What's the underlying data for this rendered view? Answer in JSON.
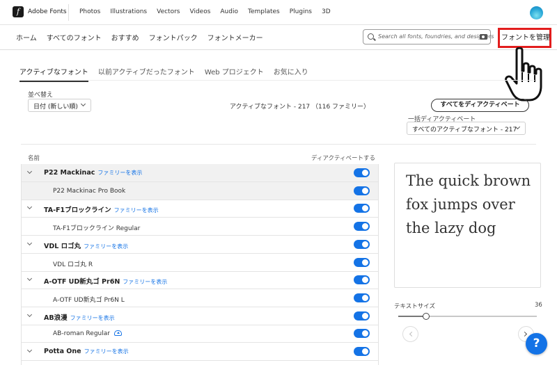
{
  "brand": {
    "name": "Adobe Fonts",
    "logo_glyph": "f"
  },
  "top_nav": [
    "Photos",
    "Illustrations",
    "Vectors",
    "Videos",
    "Audio",
    "Templates",
    "Plugins",
    "3D"
  ],
  "sub_nav": [
    "ホーム",
    "すべてのフォント",
    "おすすめ",
    "フォントパック",
    "フォントメーカー"
  ],
  "search": {
    "placeholder": "Search all fonts, foundries, and designers"
  },
  "manage_button": "フォントを管理",
  "tabs": [
    {
      "label": "アクティブなフォント",
      "active": true
    },
    {
      "label": "以前アクティブだったフォント",
      "active": false
    },
    {
      "label": "Web プロジェクト",
      "active": false
    },
    {
      "label": "お気に入り",
      "active": false
    }
  ],
  "sort": {
    "label": "並べ替え",
    "value": "日付 (新しい順)"
  },
  "summary": "アクティブなフォント - 217 （116 ファミリー）",
  "deactivate_all": "すべてをディアクティベート",
  "bulk": {
    "label": "一括ディアクティベート",
    "value": "すべてのアクティブなフォント - 217"
  },
  "columns": {
    "name": "名前",
    "deactivate": "ディアクティベートする"
  },
  "family_link": "ファミリーを表示",
  "fonts": [
    {
      "type": "family",
      "name": "P22 Mackinac",
      "selected": true,
      "active": true
    },
    {
      "type": "variant",
      "name": "P22 Mackinac Pro Book",
      "selected": true,
      "active": true
    },
    {
      "type": "family",
      "name": "TA-F1ブロックライン",
      "active": true
    },
    {
      "type": "variant",
      "name": "TA-F1ブロックライン Regular",
      "active": true
    },
    {
      "type": "family",
      "name": "VDL ロゴ丸",
      "active": true
    },
    {
      "type": "variant",
      "name": "VDL ロゴ丸 R",
      "active": true
    },
    {
      "type": "family",
      "name": "A-OTF UD新丸ゴ Pr6N",
      "active": true
    },
    {
      "type": "variant",
      "name": "A-OTF UD新丸ゴ Pr6N L",
      "active": true
    },
    {
      "type": "family",
      "name": "AB浪漫",
      "active": true
    },
    {
      "type": "variant",
      "name": "AB-roman Regular",
      "cloud": true,
      "active": true
    },
    {
      "type": "family",
      "name": "Potta One",
      "active": true
    },
    {
      "type": "variant",
      "name": "",
      "active": true
    }
  ],
  "preview": {
    "text": "The quick brown fox jumps over the lazy dog"
  },
  "text_size": {
    "label": "テキストサイズ",
    "value": "36",
    "fraction": 0.2
  },
  "help_button": "?",
  "colors": {
    "accent": "#1473e6",
    "highlight": "#e21d1d"
  }
}
